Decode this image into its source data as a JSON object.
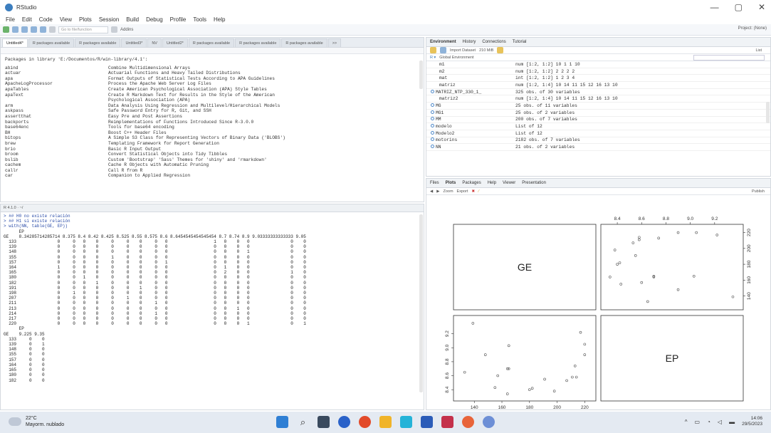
{
  "window": {
    "title": "RStudio",
    "minimize": "—",
    "restore": "▢",
    "close": "✕"
  },
  "menu": [
    "File",
    "Edit",
    "Code",
    "View",
    "Plots",
    "Session",
    "Build",
    "Debug",
    "Profile",
    "Tools",
    "Help"
  ],
  "toolbar": {
    "goto_placeholder": "Go to file/function",
    "addins": "Addins",
    "project": "Project: (None)"
  },
  "editor_tabs": [
    "Untitled4*",
    "R packages available",
    "R packages available",
    "Untitled3*",
    "NV",
    "Untitled2*",
    "R packages available",
    "R packages available",
    "R packages available",
    ">>"
  ],
  "packages": {
    "header": "Packages in library 'E:/Documentos/R/win-library/4.1':",
    "rows": [
      [
        "abind",
        "Combine Multidimensional Arrays"
      ],
      [
        "actuar",
        "Actuarial Functions and Heavy Tailed Distributions"
      ],
      [
        "apa",
        "Format Outputs of Statistical Tests According to APA Guidelines"
      ],
      [
        "ApacheLogProcessor",
        "Process the Apache Web Server Log Files"
      ],
      [
        "apaTables",
        "Create American Psychological Association (APA) Style Tables"
      ],
      [
        "apaText",
        "Create R Markdown Text for Results in the Style of the American"
      ],
      [
        "",
        "Psychological Association (APA)"
      ],
      [
        "arm",
        "Data Analysis Using Regression and Multilevel/Hierarchical Models"
      ],
      [
        "askpass",
        "Safe Password Entry for R, Git, and SSH"
      ],
      [
        "assertthat",
        "Easy Pre and Post Assertions"
      ],
      [
        "backports",
        "Reimplementations of Functions Introduced Since R-3.0.0"
      ],
      [
        "base64enc",
        "Tools for base64 encoding"
      ],
      [
        "BH",
        "Boost C++ Header Files"
      ],
      [
        "bitops",
        "A Simple S3 Class for Representing Vectors of Binary Data ('BLOBS')"
      ],
      [
        "brew",
        "Templating Framework for Report Generation"
      ],
      [
        "brio",
        "Basic R Input Output"
      ],
      [
        "broom",
        "Convert Statistical Objects into Tidy Tibbles"
      ],
      [
        "bslib",
        "Custom 'Bootstrap' 'Sass' Themes for 'shiny' and 'rmarkdown'"
      ],
      [
        "cachem",
        "Cache R Objects with Automatic Pruning"
      ],
      [
        "callr",
        "Call R from R"
      ],
      [
        "car",
        "Companion to Applied Regression"
      ]
    ]
  },
  "console": {
    "header": "R 4.1.0 · ~/",
    "lines": [
      "> ## H0 no existe relación",
      "> ## H1 si existe relación",
      "> with(NN, table(GE, EP))",
      "      EP",
      "GE    8.34285714285714 8.375 8.4 8.42 8.425 8.525 8.55 8.575 8.6 8.6454545454545454 8.7 8.74 8.9 9.03333333333333 9.05",
      "  133                0     0   0    0     0     0    0     0   0                  1   0    0   0                0    0",
      "  139                0     0   0    0     0     0    0     0   0                  0   0    0   0                0    0",
      "  148                0     0   0    0     0     0    0     0   0                  0   0    0   1                0    0",
      "  155                0     0   0    0     1     0    0     0   0                  0   0    0   0                0    0",
      "  157                0     0   0    0     0     0    0     0   1                  0   0    0   0                0    0",
      "  164                1     0   0    0     0     0    0     0   0                  0   1    0   0                0    0",
      "  165                0     0   0    0     0     0    0     0   0                  0   2    0   0                1    0",
      "  180                0     0   1    0     0     0    0     0   0                  0   0    0   0                0    0",
      "  182                0     0   0    1     0     0    0     0   0                  0   0    0   0                0    0",
      "  191                0     0   0    0     0     0    1     0   0                  0   0    0   0                0    0",
      "  198                0     1   0    0     0     0    0     0   0                  0   0    0   0                0    0",
      "  207                0     0   0    0     0     1    0     0   0                  0   0    0   0                0    0",
      "  211                0     0   0    0     0     0    0     1   0                  0   0    0   0                0    0",
      "  213                0     0   0    0     0     0    0     0   0                  0   0    1   0                0    0",
      "  214                0     0   0    0     0     0    0     1   0                  0   0    0   0                0    0",
      "  217                0     0   0    0     0     0    0     0   0                  0   0    0   0                0    0",
      "  220                0     0   0    0     0     0    0     0   0                  0   0    0   1                0    1",
      "      EP",
      "GE    9.225 9.35",
      "  133     0    0",
      "  139     0    1",
      "  148     0    0",
      "  155     0    0",
      "  157     0    0",
      "  164     0    0",
      "  165     0    0",
      "  180     0    0",
      "  182     0    0"
    ]
  },
  "env": {
    "tabs": [
      "Environment",
      "History",
      "Connections",
      "Tutorial"
    ],
    "toolbar": [
      "Import Dataset",
      "210 MiB",
      "List"
    ],
    "scope": "Global Environment",
    "rows": [
      {
        "name": "m1",
        "value": "num [1:2, 1:2] 10 1 1 10",
        "data": false
      },
      {
        "name": "m2",
        "value": "num [1:2, 1:2] 2 2 2 2",
        "data": false
      },
      {
        "name": "mat",
        "value": "int [1:2, 1:2] 1 2 3 4",
        "data": false
      },
      {
        "name": "matriz",
        "value": "num [1:2, 1:4] 10 14 11 15 12 16 13 10",
        "data": false
      },
      {
        "name": "MATRIZ_NTP_330_1_",
        "value": "325 obs. of 30 variables",
        "data": true
      },
      {
        "name": "matriz2",
        "value": "num [1:2, 1:4] 10 14 11 15 12 16 13 10",
        "data": false
      },
      {
        "name": "MG",
        "value": "25 obs. of 11 variables",
        "data": true
      },
      {
        "name": "MG1",
        "value": "25 obs. of 2 variables",
        "data": true
      },
      {
        "name": "MM",
        "value": "200 obs. of 7 variables",
        "data": true
      },
      {
        "name": "modelo",
        "value": "List of 12",
        "data": true
      },
      {
        "name": "Modelo2",
        "value": "List of 12",
        "data": true
      },
      {
        "name": "motorins",
        "value": "2182 obs. of 7 variables",
        "data": true
      },
      {
        "name": "NN",
        "value": "21 obs. of 2 variables",
        "data": true
      }
    ]
  },
  "plots": {
    "tabs": [
      "Files",
      "Plots",
      "Packages",
      "Help",
      "Viewer",
      "Presentation"
    ],
    "toolbar": [
      "Zoom",
      "Export",
      "Publish"
    ],
    "diag_labels": [
      "GE",
      "EP"
    ],
    "top_axis_ticks": [
      "8.4",
      "8.6",
      "8.8",
      "9.0",
      "9.2"
    ],
    "right_axis_ticks": [
      "140",
      "160",
      "180",
      "200",
      "220"
    ],
    "bottom_axis_ticks": [
      "140",
      "160",
      "180",
      "200",
      "220"
    ],
    "left_axis_ticks": [
      "8.4",
      "8.6",
      "8.8",
      "9.0",
      "9.2"
    ]
  },
  "chart_data": {
    "type": "scatter",
    "title": "",
    "variables": [
      "GE",
      "EP"
    ],
    "GE_range": [
      133,
      220
    ],
    "EP_range": [
      8.34,
      9.35
    ],
    "points": [
      {
        "GE": 133,
        "EP": 8.65
      },
      {
        "GE": 139,
        "EP": 9.35
      },
      {
        "GE": 148,
        "EP": 8.9
      },
      {
        "GE": 155,
        "EP": 8.43
      },
      {
        "GE": 157,
        "EP": 8.6
      },
      {
        "GE": 164,
        "EP": 8.34
      },
      {
        "GE": 164,
        "EP": 8.7
      },
      {
        "GE": 165,
        "EP": 8.7
      },
      {
        "GE": 165,
        "EP": 9.03
      },
      {
        "GE": 180,
        "EP": 8.4
      },
      {
        "GE": 182,
        "EP": 8.42
      },
      {
        "GE": 191,
        "EP": 8.55
      },
      {
        "GE": 198,
        "EP": 8.38
      },
      {
        "GE": 207,
        "EP": 8.53
      },
      {
        "GE": 211,
        "EP": 8.58
      },
      {
        "GE": 213,
        "EP": 8.74
      },
      {
        "GE": 214,
        "EP": 8.58
      },
      {
        "GE": 217,
        "EP": 9.22
      },
      {
        "GE": 220,
        "EP": 8.9
      },
      {
        "GE": 220,
        "EP": 9.05
      }
    ]
  },
  "taskbar": {
    "temp": "22°C",
    "weather": "Mayorm. nublado",
    "time": "14:06",
    "date": "29/5/2023"
  }
}
